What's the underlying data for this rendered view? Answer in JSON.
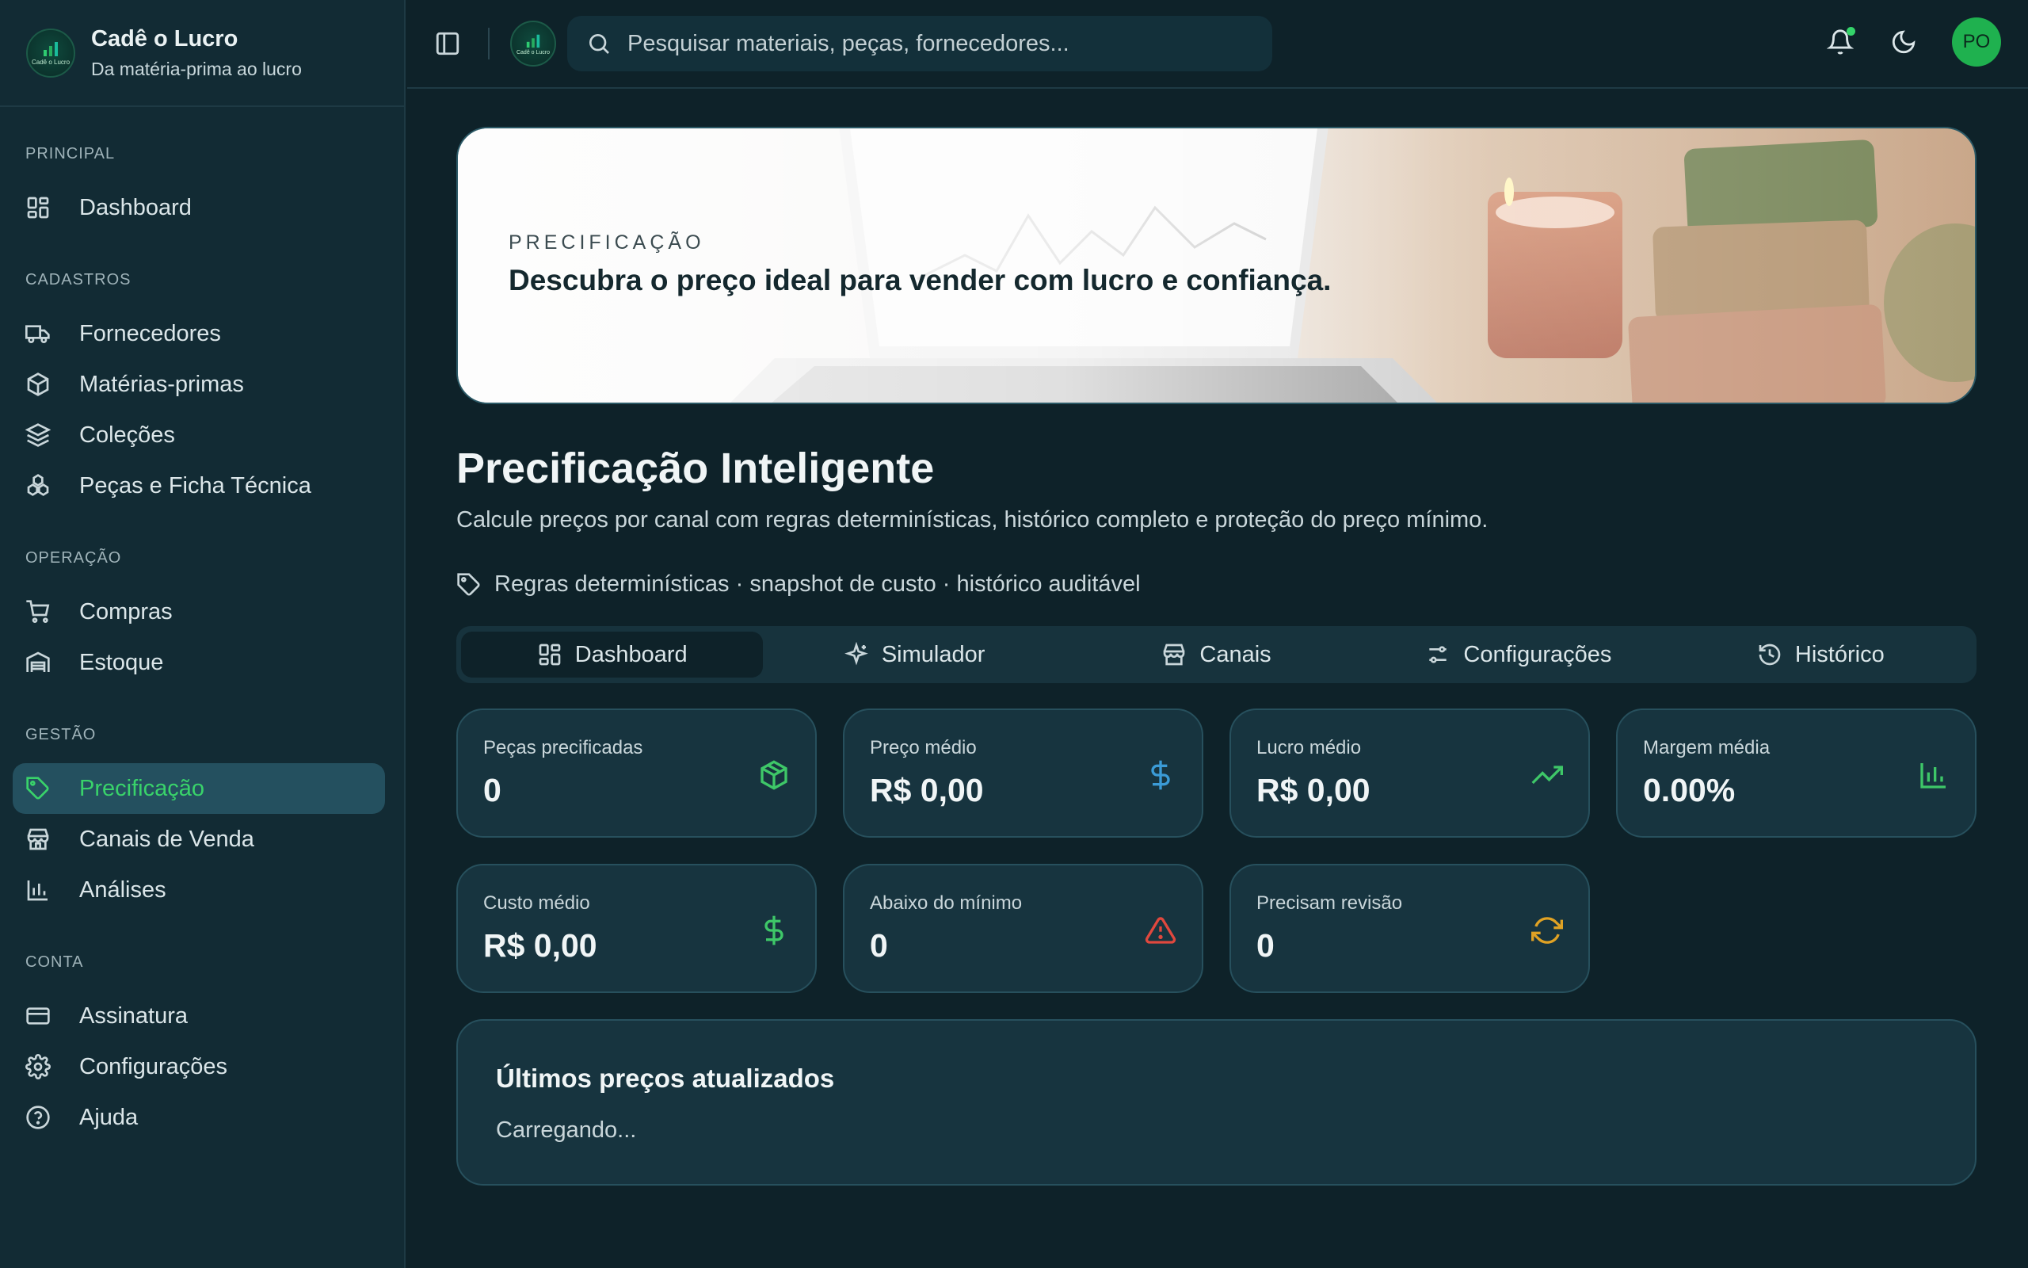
{
  "brand": {
    "title": "Cadê o Lucro",
    "subtitle": "Da matéria-prima ao lucro",
    "logo_text": "Cadê o Lucro"
  },
  "sidebar": {
    "sections": [
      {
        "label": "PRINCIPAL",
        "items": [
          {
            "label": "Dashboard",
            "icon": "dashboard-icon"
          }
        ]
      },
      {
        "label": "CADASTROS",
        "items": [
          {
            "label": "Fornecedores",
            "icon": "truck-icon"
          },
          {
            "label": "Matérias-primas",
            "icon": "box-icon"
          },
          {
            "label": "Coleções",
            "icon": "layers-icon"
          },
          {
            "label": "Peças e Ficha Técnica",
            "icon": "pieces-icon"
          }
        ]
      },
      {
        "label": "OPERAÇÃO",
        "items": [
          {
            "label": "Compras",
            "icon": "cart-icon"
          },
          {
            "label": "Estoque",
            "icon": "warehouse-icon"
          }
        ]
      },
      {
        "label": "GESTÃO",
        "items": [
          {
            "label": "Precificação",
            "icon": "tag-icon",
            "active": true
          },
          {
            "label": "Canais de Venda",
            "icon": "store-icon"
          },
          {
            "label": "Análises",
            "icon": "bar-chart-icon"
          }
        ]
      },
      {
        "label": "CONTA",
        "items": [
          {
            "label": "Assinatura",
            "icon": "credit-card-icon"
          },
          {
            "label": "Configurações",
            "icon": "gear-icon"
          },
          {
            "label": "Ajuda",
            "icon": "help-icon"
          }
        ]
      }
    ]
  },
  "header": {
    "search_placeholder": "Pesquisar materiais, peças, fornecedores...",
    "avatar_initials": "PO",
    "notification_dot_color": "#34d46a"
  },
  "banner": {
    "kicker": "PRECIFICAÇÃO",
    "title": "Descubra o preço ideal para vender com lucro e confiança."
  },
  "page": {
    "title": "Precificação Inteligente",
    "description": "Calcule preços por canal com regras determinísticas, histórico completo e proteção do preço mínimo.",
    "rules_line": "Regras determinísticas · snapshot de custo · histórico auditável"
  },
  "tabs": [
    {
      "label": "Dashboard",
      "icon": "dashboard-icon",
      "active": true
    },
    {
      "label": "Simulador",
      "icon": "sparkles-icon"
    },
    {
      "label": "Canais",
      "icon": "store-icon"
    },
    {
      "label": "Configurações",
      "icon": "sliders-icon"
    },
    {
      "label": "Histórico",
      "icon": "history-icon"
    }
  ],
  "stats": [
    {
      "label": "Peças precificadas",
      "value": "0",
      "icon": "package-icon",
      "color": "#3ec768"
    },
    {
      "label": "Preço médio",
      "value": "R$ 0,00",
      "icon": "dollar-icon",
      "color": "#3b9bd6"
    },
    {
      "label": "Lucro médio",
      "value": "R$ 0,00",
      "icon": "trending-up-icon",
      "color": "#3ec768"
    },
    {
      "label": "Margem média",
      "value": "0.00%",
      "icon": "bar-chart-icon",
      "color": "#3ec768"
    },
    {
      "label": "Custo médio",
      "value": "R$ 0,00",
      "icon": "dollar-icon",
      "color": "#3ec768"
    },
    {
      "label": "Abaixo do mínimo",
      "value": "0",
      "icon": "alert-triangle-icon",
      "color": "#e0483e"
    },
    {
      "label": "Precisam revisão",
      "value": "0",
      "icon": "refresh-icon",
      "color": "#e0a224"
    }
  ],
  "recent": {
    "title": "Últimos preços atualizados",
    "status": "Carregando..."
  },
  "colors": {
    "accent": "#39d36a",
    "background": "#0e2229",
    "sidebar": "#122b34",
    "card": "#17343f"
  }
}
